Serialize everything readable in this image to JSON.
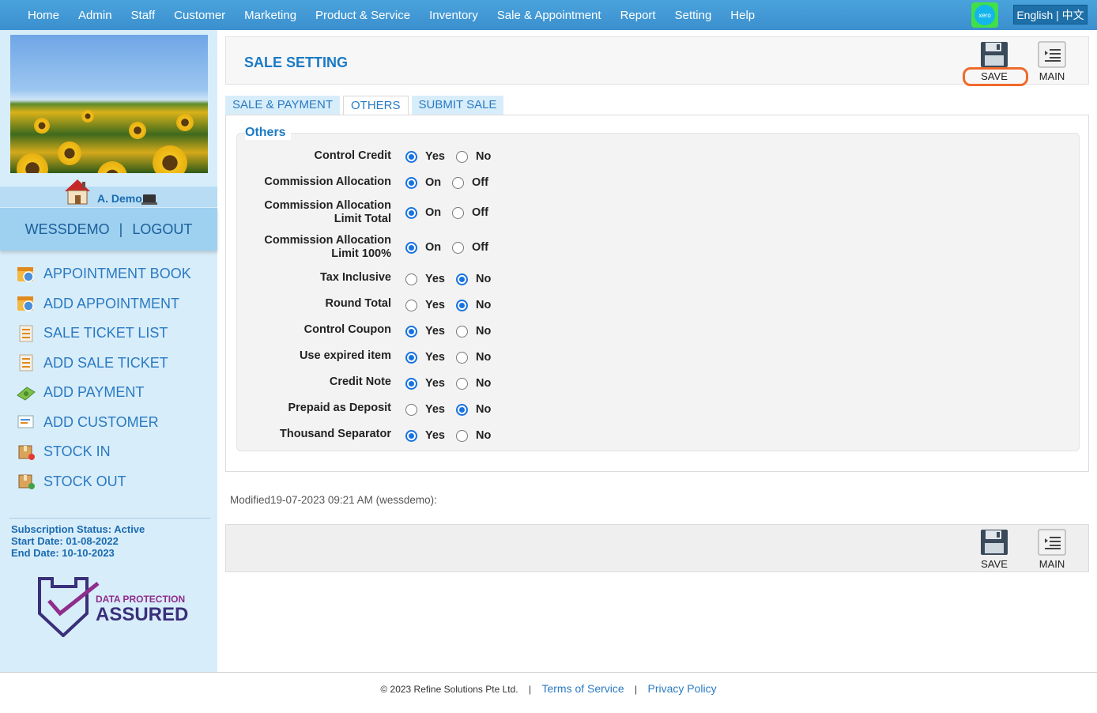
{
  "nav": {
    "items": [
      "Home",
      "Admin",
      "Staff",
      "Customer",
      "Marketing",
      "Product & Service",
      "Inventory",
      "Sale & Appointment",
      "Report",
      "Setting",
      "Help"
    ],
    "xero_label": "xero",
    "language": "English | 中文"
  },
  "sidebar": {
    "user_name": "A. Demo",
    "session_user": "WESSDEMO",
    "session_sep": "|",
    "logout": "LOGOUT",
    "quick_links": [
      "APPOINTMENT BOOK",
      "ADD APPOINTMENT",
      "SALE TICKET LIST",
      "ADD SALE TICKET",
      "ADD PAYMENT",
      "ADD CUSTOMER",
      "STOCK IN",
      "STOCK OUT"
    ],
    "subscription": {
      "status": "Subscription Status: Active",
      "start": "Start Date: 01-08-2022",
      "end": "End Date: 10-10-2023"
    },
    "badge": {
      "line1": "DATA PROTECTION",
      "line2": "ASSURED"
    }
  },
  "header": {
    "title": "SALE SETTING",
    "save_label": "SAVE",
    "main_label": "MAIN"
  },
  "tabs": [
    "SALE & PAYMENT",
    "OTHERS",
    "SUBMIT SALE"
  ],
  "others": {
    "legend": "Others",
    "settings": [
      {
        "label": "Control Credit",
        "options": [
          "Yes",
          "No"
        ],
        "selected": 0
      },
      {
        "label": "Commission Allocation",
        "options": [
          "On",
          "Off"
        ],
        "selected": 0
      },
      {
        "label": "Commission Allocation Limit Total",
        "options": [
          "On",
          "Off"
        ],
        "selected": 0
      },
      {
        "label": "Commission Allocation Limit 100%",
        "options": [
          "On",
          "Off"
        ],
        "selected": 0
      },
      {
        "label": "Tax Inclusive",
        "options": [
          "Yes",
          "No"
        ],
        "selected": 1
      },
      {
        "label": "Round Total",
        "options": [
          "Yes",
          "No"
        ],
        "selected": 1
      },
      {
        "label": "Control Coupon",
        "options": [
          "Yes",
          "No"
        ],
        "selected": 0
      },
      {
        "label": "Use expired item",
        "options": [
          "Yes",
          "No"
        ],
        "selected": 0
      },
      {
        "label": "Credit Note",
        "options": [
          "Yes",
          "No"
        ],
        "selected": 0
      },
      {
        "label": "Prepaid as Deposit",
        "options": [
          "Yes",
          "No"
        ],
        "selected": 1
      },
      {
        "label": "Thousand Separator",
        "options": [
          "Yes",
          "No"
        ],
        "selected": 0
      }
    ]
  },
  "modified": "Modified19-07-2023 09:21 AM (wessdemo):",
  "footer": {
    "copyright": "© 2023 Refine Solutions Pte Ltd.",
    "terms": "Terms of Service",
    "privacy": "Privacy Policy",
    "sep": "|"
  },
  "colors": {
    "nav": "#3b8fce",
    "accent": "#1a7ac4",
    "sidebar": "#d8edfa",
    "radio": "#1773e0",
    "highlight": "#f06a2b"
  }
}
